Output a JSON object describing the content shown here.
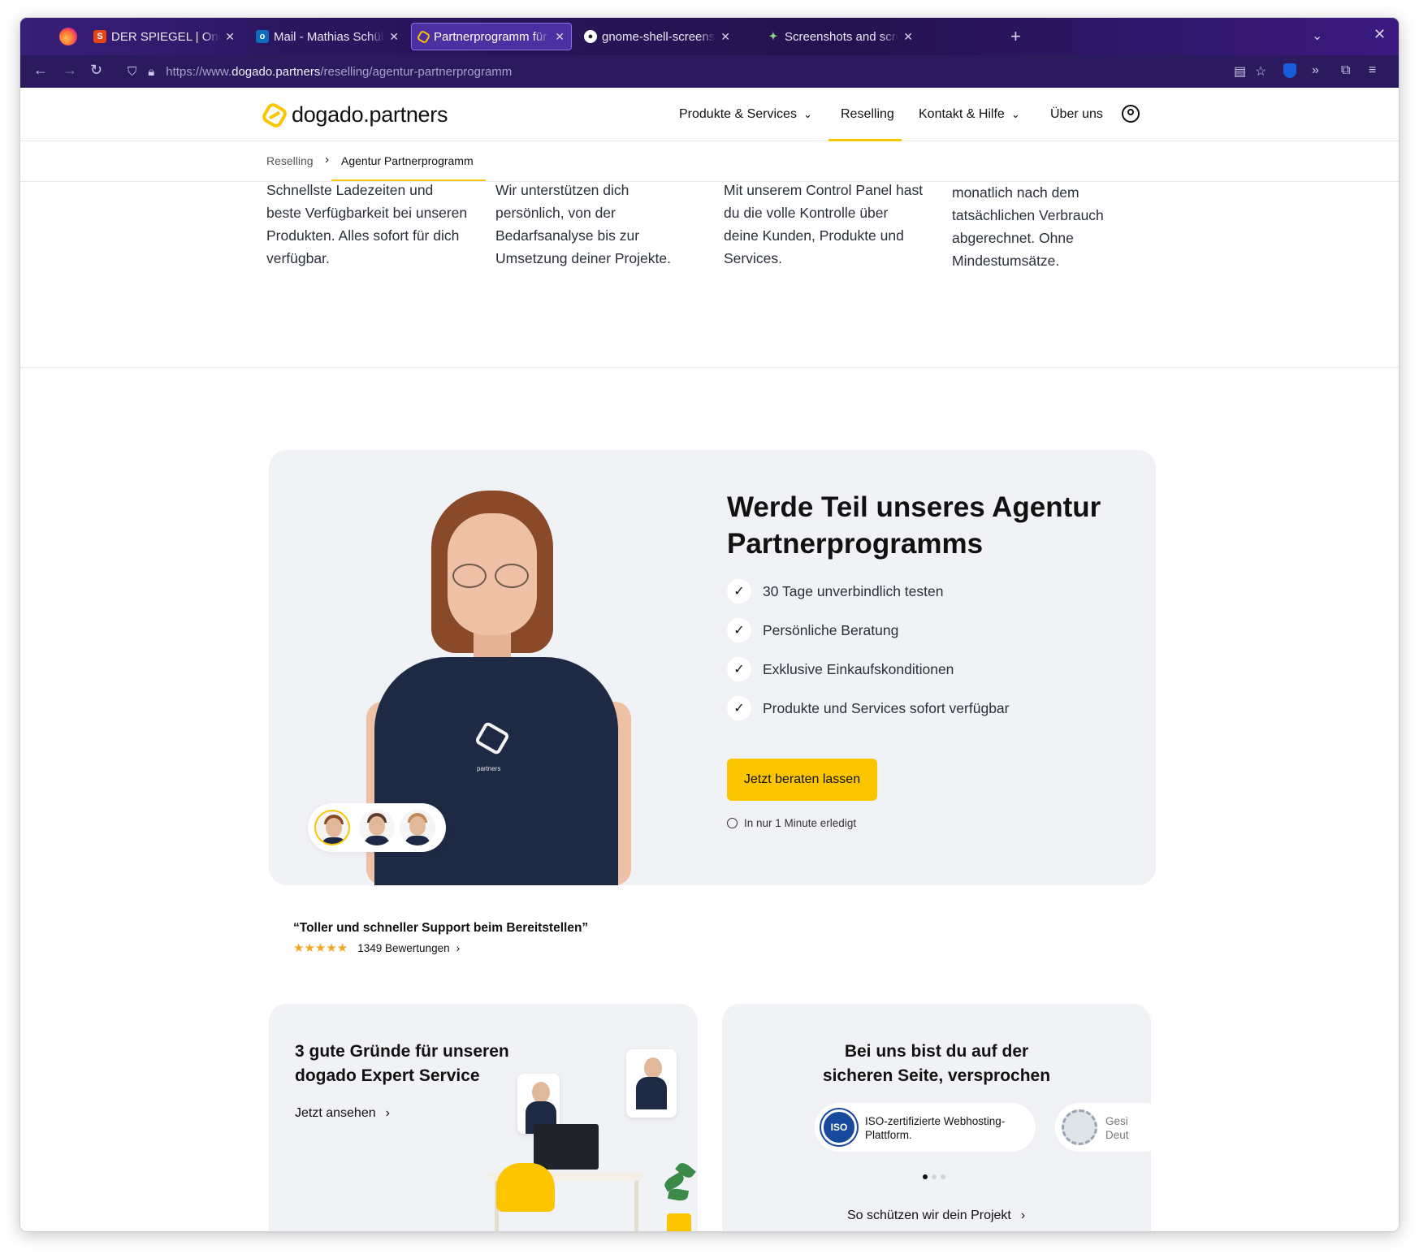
{
  "browser": {
    "tabs": [
      {
        "label": "DER SPIEGEL | Online-Nachrichten",
        "favicon": "spiegel-icon",
        "active": false
      },
      {
        "label": "Mail - Mathias Schübel - Outlook",
        "favicon": "outlook-icon",
        "active": false
      },
      {
        "label": "Partnerprogramm für Agenturen",
        "favicon": "dogado-icon",
        "active": true
      },
      {
        "label": "gnome-shell-screenshot/",
        "favicon": "github-icon",
        "active": false
      },
      {
        "label": "Screenshots and screencasts",
        "favicon": "gnome-icon",
        "active": false
      }
    ],
    "url_prefix": "https://www.",
    "url_host": "dogado.partners",
    "url_path": "/reselling/agentur-partnerprogramm",
    "accent_color": "#2b1a5e"
  },
  "site": {
    "logo_name": "dogado",
    "logo_dot": ".",
    "logo_suffix": "partners",
    "brand_color": "#fbc500",
    "nav": {
      "products": "Produkte & Services",
      "reselling": "Reselling",
      "contact": "Kontakt & Hilfe",
      "about": "Über uns"
    },
    "breadcrumb": {
      "parent": "Reselling",
      "current": "Agentur Partnerprogramm"
    }
  },
  "features": [
    {
      "text": "Schnellste Ladezeiten und beste Verfügbarkeit bei unseren Produkten. Alles sofort für dich verfügbar."
    },
    {
      "text": "Wir unterstützen dich persönlich, von der Bedarfsanalyse bis zur Umsetzung deiner Projekte."
    },
    {
      "text": "Mit unserem Control Panel hast du die volle Kontrolle über deine Kunden, Produkte und Services."
    },
    {
      "text": "monatlich nach dem tatsächlichen Verbrauch abgerechnet. Ohne Mindestumsätze."
    }
  ],
  "hero": {
    "shirt_text": "partners",
    "title": "Werde Teil unseres Agentur Partnerprogramms",
    "checks": [
      "30 Tage unverbindlich testen",
      "Persönliche Beratung",
      "Exklusive Einkaufskonditionen",
      "Produkte und Services sofort verfügbar"
    ],
    "cta_label": "Jetzt beraten lassen",
    "cta_note": "In nur 1 Minute erledigt"
  },
  "review": {
    "quote": "“Toller und schneller Support beim Bereitstellen”",
    "rating": 5,
    "stars": "★★★★★",
    "count_label": "1349 Bewertungen"
  },
  "cards": {
    "expert": {
      "title_line1": "3 gute Gründe für unseren",
      "title_line2": "dogado Expert Service",
      "link": "Jetzt ansehen"
    },
    "security": {
      "title_line1": "Bei uns bist du auf der",
      "title_line2": "sicheren Seite, versprochen",
      "iso_label": "ISO",
      "badge1_line1": "ISO-zertifizierte Webhosting-",
      "badge1_line2": "Plattform.",
      "badge2_line1": "Gesi",
      "badge2_line2": "Deut",
      "link": "So schützen wir dein Projekt"
    }
  }
}
